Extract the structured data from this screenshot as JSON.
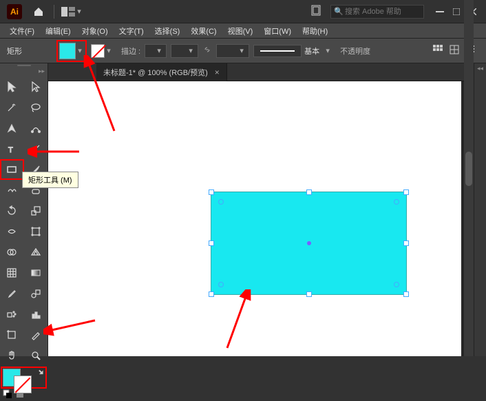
{
  "titlebar": {
    "logo": "Ai",
    "search_placeholder": "搜索 Adobe 帮助"
  },
  "menu": {
    "file": "文件(F)",
    "edit": "编辑(E)",
    "object": "对象(O)",
    "type": "文字(T)",
    "select": "选择(S)",
    "effect": "效果(C)",
    "view": "视图(V)",
    "window": "窗口(W)",
    "help": "帮助(H)"
  },
  "control": {
    "shape": "矩形",
    "stroke_label": "描边 :",
    "stroke_weight": "",
    "profile_label": "基本",
    "opacity_label": "不透明度"
  },
  "tab": {
    "title": "未标题-1* @ 100% (RGB/预览)"
  },
  "tooltip": {
    "rect_tool": "矩形工具 (M)"
  },
  "colors": {
    "fill": "#2ae8e8",
    "shape_fill": "#18e8f0"
  }
}
